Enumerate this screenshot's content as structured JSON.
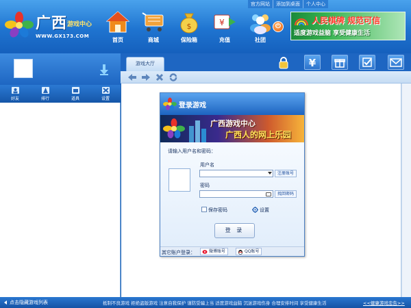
{
  "header": {
    "logo_title": "广西",
    "logo_subtitle": "游戏中心",
    "logo_url": "WWW.GX173.COM",
    "top_links": [
      "官方网站",
      "添加到桌面",
      "个人中心"
    ],
    "nav": [
      {
        "label": "首页",
        "icon": "home-icon"
      },
      {
        "label": "商城",
        "icon": "shopping-cart-icon"
      },
      {
        "label": "保险箱",
        "icon": "money-bag-icon"
      },
      {
        "label": "充值",
        "icon": "recharge-icon"
      },
      {
        "label": "社团",
        "icon": "community-icon"
      }
    ],
    "ad_line1": "人民棋牌 规范可信",
    "ad_line2": "适度游戏益脑 享受健康生活"
  },
  "sidebar": {
    "tools": [
      {
        "label": "好友",
        "icon": "friends-icon"
      },
      {
        "label": "排行",
        "icon": "ranking-icon"
      },
      {
        "label": "道具",
        "icon": "props-icon"
      },
      {
        "label": "设置",
        "icon": "settings-icon"
      }
    ]
  },
  "tabs": [
    {
      "label": "游戏大厅"
    }
  ],
  "right_tools": [
    "lock-icon",
    "yen-icon",
    "gift-icon",
    "checkbox-icon",
    "mail-icon"
  ],
  "login": {
    "title": "登录游戏",
    "banner_line1": "广西游戏中心",
    "banner_line2": "广西人的网上乐园",
    "prompt": "请输入用户名和密码：",
    "username_label": "用户名",
    "username_value": "",
    "register_link": "注册账号",
    "password_label": "密码",
    "password_value": "",
    "recover_link": "找回密码",
    "remember_label": "保存密码",
    "settings_label": "设置",
    "login_button": "登 录",
    "other_login_label": "其它账户登录：",
    "weibo_label": "微博账号",
    "qq_label": "QQ账号"
  },
  "bottom": {
    "hide_list": "点击隐藏游戏列表",
    "notice": "抵制不良游戏  拒绝盗版游戏  注意自我保护  谨防受骗上当  适度游戏益脑  沉迷游戏伤身  合理安排时间  享受健康生活",
    "notice_link": "<<健康游戏忠告>>"
  },
  "colors": {
    "header_blue": "#1f74d0",
    "dialog_border": "#4a7fc3",
    "ad_red": "#ff3a2a"
  }
}
